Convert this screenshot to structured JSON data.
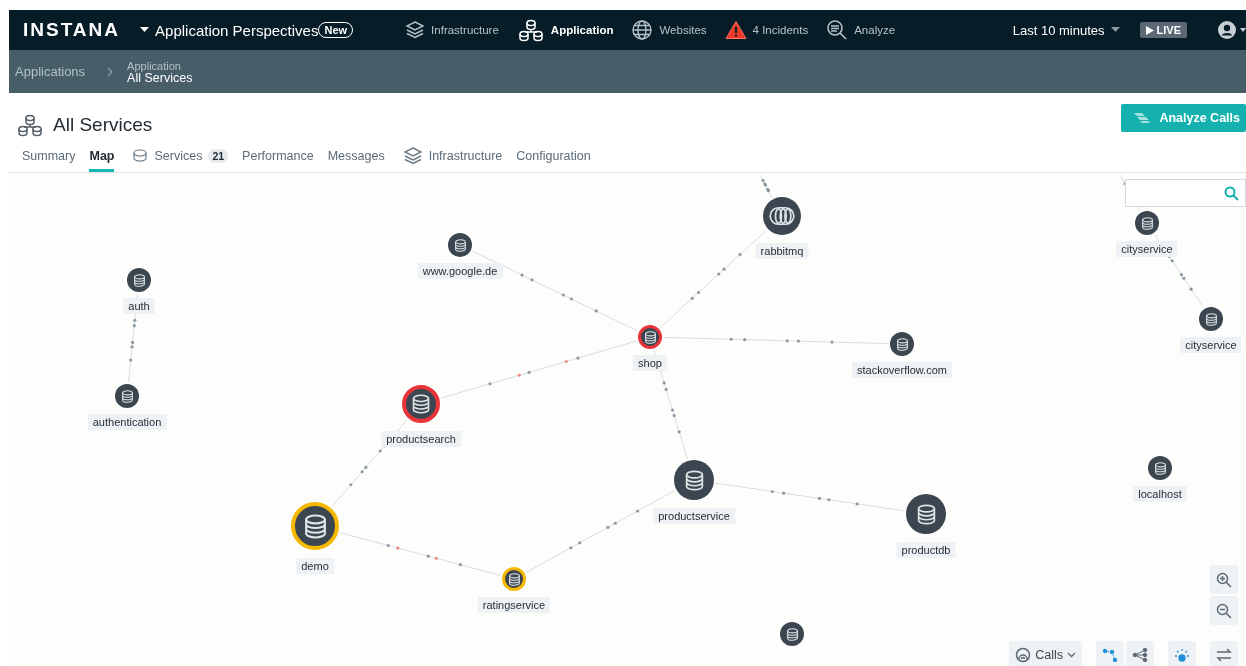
{
  "topbar": {
    "logo": "INSTANA",
    "perspectives": "Application Perspectives",
    "new_badge": "New",
    "nav": [
      {
        "label": "Infrastructure",
        "selected": false
      },
      {
        "label": "Application",
        "selected": true
      },
      {
        "label": "Websites",
        "selected": false
      },
      {
        "label": "4 Incidents",
        "selected": false
      },
      {
        "label": "Analyze",
        "selected": false
      }
    ],
    "time_range": "Last 10 minutes",
    "live": "LIVE"
  },
  "breadcrumb": {
    "root": "Applications",
    "parent": "Application",
    "current": "All Services"
  },
  "page": {
    "title": "All Services",
    "analyze_button": "Analyze Calls"
  },
  "tabs": [
    {
      "label": "Summary",
      "selected": false
    },
    {
      "label": "Map",
      "selected": true
    },
    {
      "label": "Services",
      "count": "21",
      "selected": false
    },
    {
      "label": "Performance",
      "selected": false
    },
    {
      "label": "Messages",
      "selected": false
    },
    {
      "label": "Infrastructure",
      "selected": false
    },
    {
      "label": "Configuration",
      "selected": false
    }
  ],
  "map": {
    "calls_menu": "Calls",
    "nodes": [
      {
        "label": "auth",
        "kind": "database"
      },
      {
        "label": "authentication",
        "kind": "database"
      },
      {
        "label": "www.google.de",
        "kind": "database"
      },
      {
        "label": "rabbitmq",
        "kind": "queue"
      },
      {
        "label": "shop",
        "kind": "database",
        "color": "#e8353a"
      },
      {
        "label": "stackoverflow.com",
        "kind": "database"
      },
      {
        "label": "productsearch",
        "kind": "database",
        "color": "#e8353a"
      },
      {
        "label": "productservice",
        "kind": "database"
      },
      {
        "label": "productdb",
        "kind": "database"
      },
      {
        "label": "demo",
        "kind": "database",
        "color": "#f5b800"
      },
      {
        "label": "ratingservice",
        "kind": "database",
        "color": "#f5b800"
      },
      {
        "label": "cityservice",
        "kind": "database"
      },
      {
        "label": "cityservice",
        "kind": "database"
      },
      {
        "label": "localhost",
        "kind": "database"
      },
      {
        "kind": "database"
      }
    ]
  }
}
